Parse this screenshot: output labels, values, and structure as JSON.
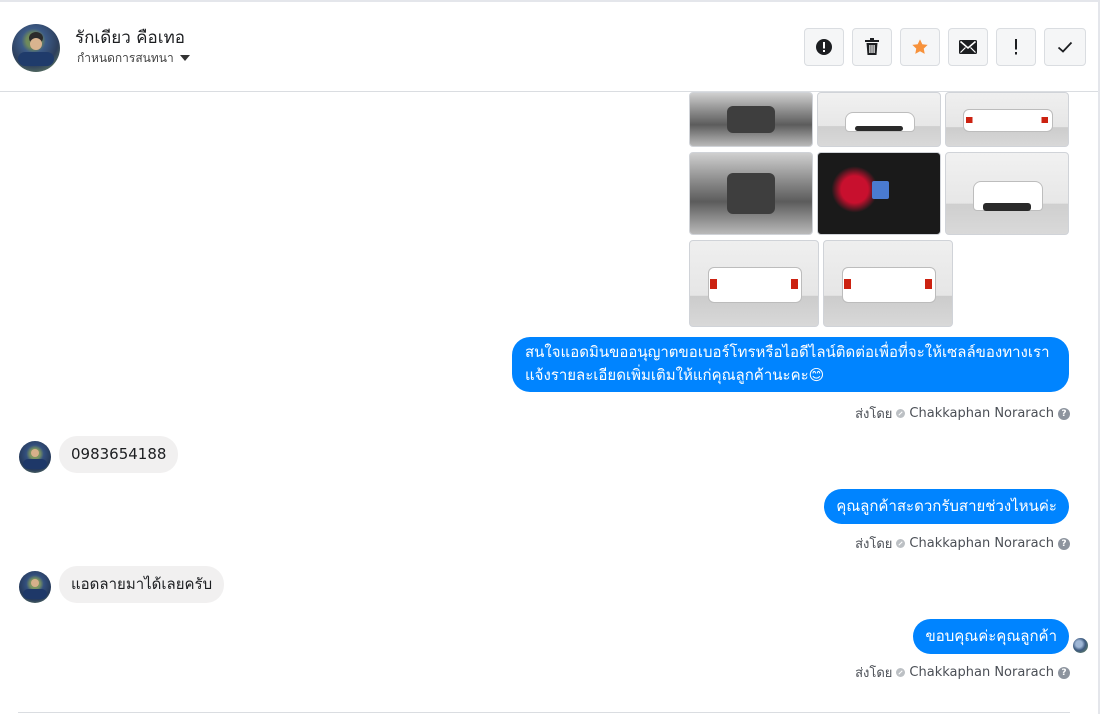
{
  "header": {
    "name": "รักเดียว คือเทอ",
    "subtitle": "กำหนดการสนทนา"
  },
  "toolbar": {
    "buttons": [
      {
        "icon": "alert-circle-icon"
      },
      {
        "icon": "trash-icon"
      },
      {
        "icon": "star-icon",
        "color": "#f7923b"
      },
      {
        "icon": "mail-icon"
      },
      {
        "icon": "exclamation-icon"
      },
      {
        "icon": "checkmark-icon"
      }
    ]
  },
  "messages": {
    "m1": {
      "line1": "สนใจแอดมินขออนุญาตขอเบอร์โทรหรือไอดีไลน์ติดต่อเพื่อที่จะให้เซลล์ของทางเรา",
      "line2": "แจ้งรายละเอียดเพิ่มเติมให้แก่คุณลูกค้านะคะ😊",
      "sent_label": "ส่งโดย",
      "sender": "Chakkaphan Norarach"
    },
    "m2": {
      "text": "0983654188"
    },
    "m3": {
      "text": "คุณลูกค้าสะดวกรับสายช่วงไหนค่ะ",
      "sent_label": "ส่งโดย",
      "sender": "Chakkaphan Norarach"
    },
    "m4": {
      "text": "แอดลายมาได้เลยครับ"
    },
    "m5": {
      "text": "ขอบคุณค่ะคุณลูกค้า",
      "sent_label": "ส่งโดย",
      "sender": "Chakkaphan Norarach"
    }
  },
  "help_glyph": "?",
  "colors": {
    "outgoing_bubble": "#0084ff",
    "incoming_bubble": "#f1f0f0",
    "star": "#f7923b"
  }
}
